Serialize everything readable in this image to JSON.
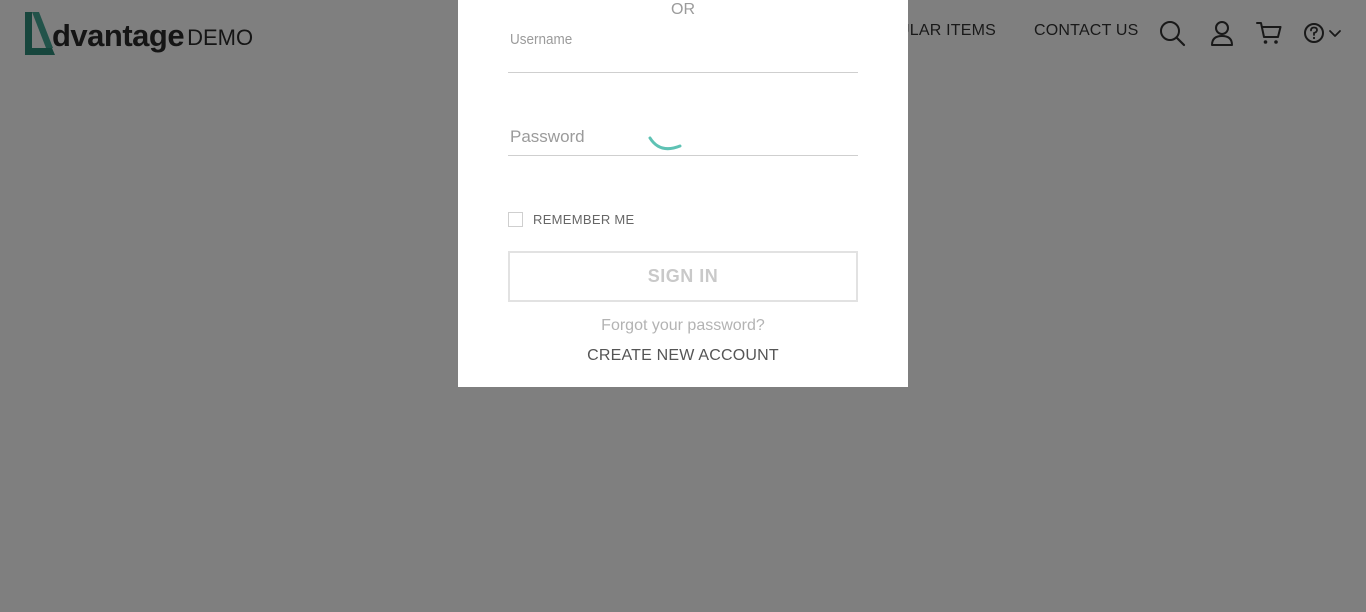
{
  "header": {
    "logo_word": "dvantage",
    "logo_suffix": "DEMO",
    "nav": {
      "popular_items": "ULAR ITEMS",
      "contact_us": "CONTACT US"
    },
    "icons": [
      "search-icon",
      "user-icon",
      "cart-icon",
      "help-icon",
      "chevron-down-icon"
    ]
  },
  "modal": {
    "or_text": "OR",
    "username": {
      "label": "Username",
      "value": ""
    },
    "password": {
      "label": "Password",
      "value": ""
    },
    "remember_me": {
      "label": "REMEMBER ME",
      "checked": false
    },
    "sign_in_label": "SIGN IN",
    "forgot_password": "Forgot your password?",
    "create_account": "CREATE NEW ACCOUNT"
  },
  "colors": {
    "overlay": "rgba(0,0,0,0.5)",
    "accent": "#5ec2b4",
    "logo_mark": "#2f8c7b"
  }
}
